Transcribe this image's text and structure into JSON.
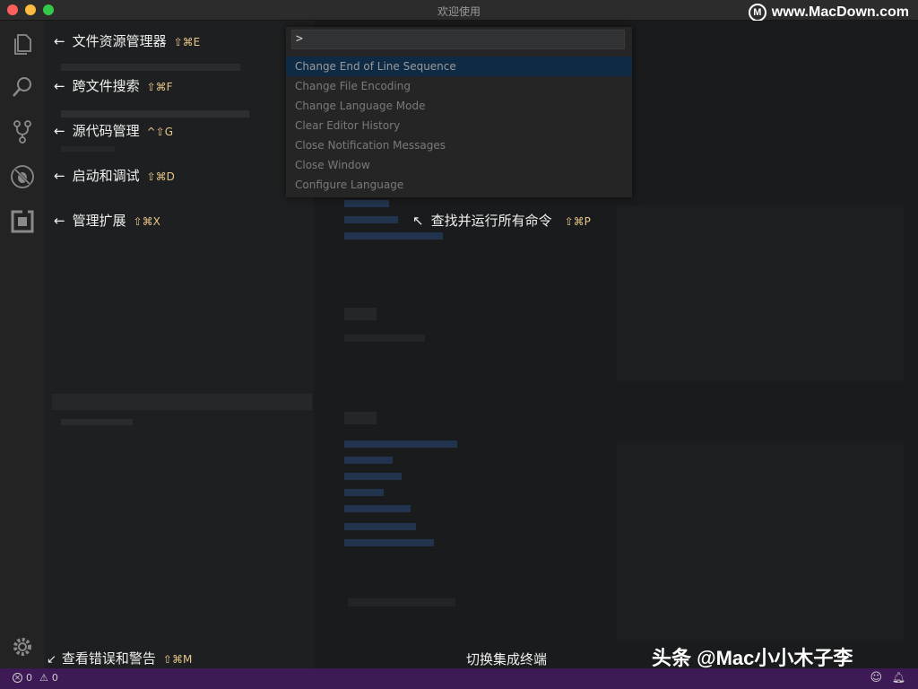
{
  "window": {
    "title": "欢迎使用"
  },
  "watermark": {
    "logo": "M",
    "text": "www.MacDown.com"
  },
  "activitybar": {
    "icons": [
      "files-icon",
      "search-icon",
      "source-control-icon",
      "debug-icon",
      "extensions-icon",
      "gear-icon"
    ]
  },
  "hints": [
    {
      "label": "文件资源管理器",
      "shortcut": "⇧⌘E"
    },
    {
      "label": "跨文件搜索",
      "shortcut": "⇧⌘F"
    },
    {
      "label": "源代码管理",
      "shortcut": "^⇧G"
    },
    {
      "label": "启动和调试",
      "shortcut": "⇧⌘D"
    },
    {
      "label": "管理扩展",
      "shortcut": "⇧⌘X"
    }
  ],
  "palette_hint": {
    "label": "查找并运行所有命令",
    "shortcut": "⇧⌘P"
  },
  "errors_hint": {
    "label": "查看错误和警告",
    "shortcut": "⇧⌘M"
  },
  "terminal_hint": {
    "label": "切换集成终端"
  },
  "command_palette": {
    "input_value": ">",
    "items": [
      "Change End of Line Sequence",
      "Change File Encoding",
      "Change Language Mode",
      "Clear Editor History",
      "Close Notification Messages",
      "Close Window",
      "Configure Language"
    ],
    "selected_index": 0
  },
  "statusbar": {
    "errors": "0",
    "warnings": "0"
  },
  "brand": {
    "text": "头条 @Mac小小木子李"
  },
  "colors": {
    "statusbar": "#3d1a55",
    "hint_key": "#e8c68a",
    "selection": "#0f2a44"
  }
}
